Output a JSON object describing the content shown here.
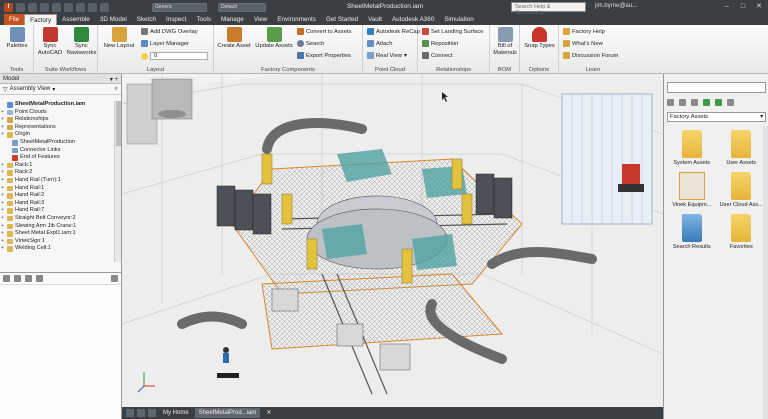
{
  "window": {
    "title": "SheetMetalProduction.iam",
    "search_placeholder": "Search Help & Commands...",
    "user": "jim.byrne@au...",
    "qa_select1": "Generic",
    "qa_select2": "Default"
  },
  "tabs": [
    "File",
    "Factory",
    "Assemble",
    "3D Model",
    "Sketch",
    "Inspect",
    "Tools",
    "Manage",
    "View",
    "Environments",
    "Get Started",
    "Vault",
    "Autodesk A360",
    "Simulation"
  ],
  "active_tab": "Factory",
  "ribbon": {
    "groups": {
      "tools": "Tools",
      "suite": "Suite Workflows",
      "layout": "Layout",
      "factory": "Factory Components",
      "pointcloud": "Point Cloud",
      "relationships": "Relationships",
      "bom": "BOM",
      "options": "Options",
      "learn": "Learn"
    },
    "palettes": "Palettes",
    "sync_autocad": "Sync AutoCAD",
    "sync_navisworks": "Sync Navisworks",
    "new_layout": "New Layout",
    "add_dwg_overlay": "Add DWG Overlay",
    "layer_manager": "Layer Manager",
    "layer_value": "0",
    "create_asset": "Create Asset",
    "update_assets": "Update Assets",
    "convert_to_assets": "Convert to Assets",
    "search": "Search",
    "export_properties": "Export Properties",
    "autodesk_recap": "Autodesk ReCap",
    "attach": "Attach",
    "real_view": "Real View",
    "set_landing_surface": "Set Landing Surface",
    "reposition": "Reposition",
    "connect": "Connect",
    "bill_of_materials": "Bill of Materials",
    "snap_types": "Snap Types",
    "factory_help": "Factory Help",
    "whats_new": "What's New",
    "discussion_forum": "Discussion Forum"
  },
  "left_panel": {
    "header": "Model",
    "view_label": "Assembly View",
    "tree": [
      {
        "label": "SheetMetalProduction.iam",
        "bold": true,
        "exp": "",
        "color": "#5b8fd1"
      },
      {
        "label": "Point Clouds",
        "exp": "+",
        "color": "#9ab7d9"
      },
      {
        "label": "Relationships",
        "exp": "+",
        "color": "#d2a64a"
      },
      {
        "label": "Representations",
        "exp": "+",
        "color": "#d2a64a"
      },
      {
        "label": "Origin",
        "exp": "+",
        "color": "#e0b653"
      },
      {
        "label": "SheetMetalProduction",
        "exp": "",
        "color": "#7aa0c8"
      },
      {
        "label": "Connector Links",
        "exp": "",
        "color": "#7aa0c8"
      },
      {
        "label": "End of Features",
        "exp": "",
        "color": "#d33a2a"
      },
      {
        "label": "Rack:1",
        "exp": "+",
        "color": "#e0b653"
      },
      {
        "label": "Rack:2",
        "exp": "+",
        "color": "#e0b653"
      },
      {
        "label": "Hand Rail (Turn):1",
        "exp": "+",
        "color": "#e0b653"
      },
      {
        "label": "Hand Rail:1",
        "exp": "+",
        "color": "#e0b653"
      },
      {
        "label": "Hand Rail:2",
        "exp": "+",
        "color": "#e0b653"
      },
      {
        "label": "Hand Rail:3",
        "exp": "+",
        "color": "#e0b653"
      },
      {
        "label": "Hand Rail:7",
        "exp": "+",
        "color": "#e0b653"
      },
      {
        "label": "Straight Belt Conveyor:2",
        "exp": "+",
        "color": "#e0b653"
      },
      {
        "label": "Slewing Arm Jib Crane:1",
        "exp": "+",
        "color": "#e0b653"
      },
      {
        "label": "Sheet Metal Expl1.iam:1",
        "exp": "+",
        "color": "#e0b653"
      },
      {
        "label": "VirtekSign:1",
        "exp": "+",
        "color": "#e0b653"
      },
      {
        "label": "Welding Cell:1",
        "exp": "+",
        "color": "#e0b653"
      }
    ]
  },
  "right_panel": {
    "dropdown": "Factory Assets",
    "assets": [
      {
        "label": "System Assets",
        "kind": "folder"
      },
      {
        "label": "User Assets",
        "kind": "folder"
      },
      {
        "label": "Vinek Equipm...",
        "kind": "image"
      },
      {
        "label": "User Cloud Ass...",
        "kind": "folder"
      },
      {
        "label": "Search Results",
        "kind": "blue"
      },
      {
        "label": "Favorites",
        "kind": "folder"
      }
    ]
  },
  "doc_tabs": [
    "My Home",
    "SheetMetalProd...iam"
  ],
  "active_doc": "SheetMetalProd...iam"
}
